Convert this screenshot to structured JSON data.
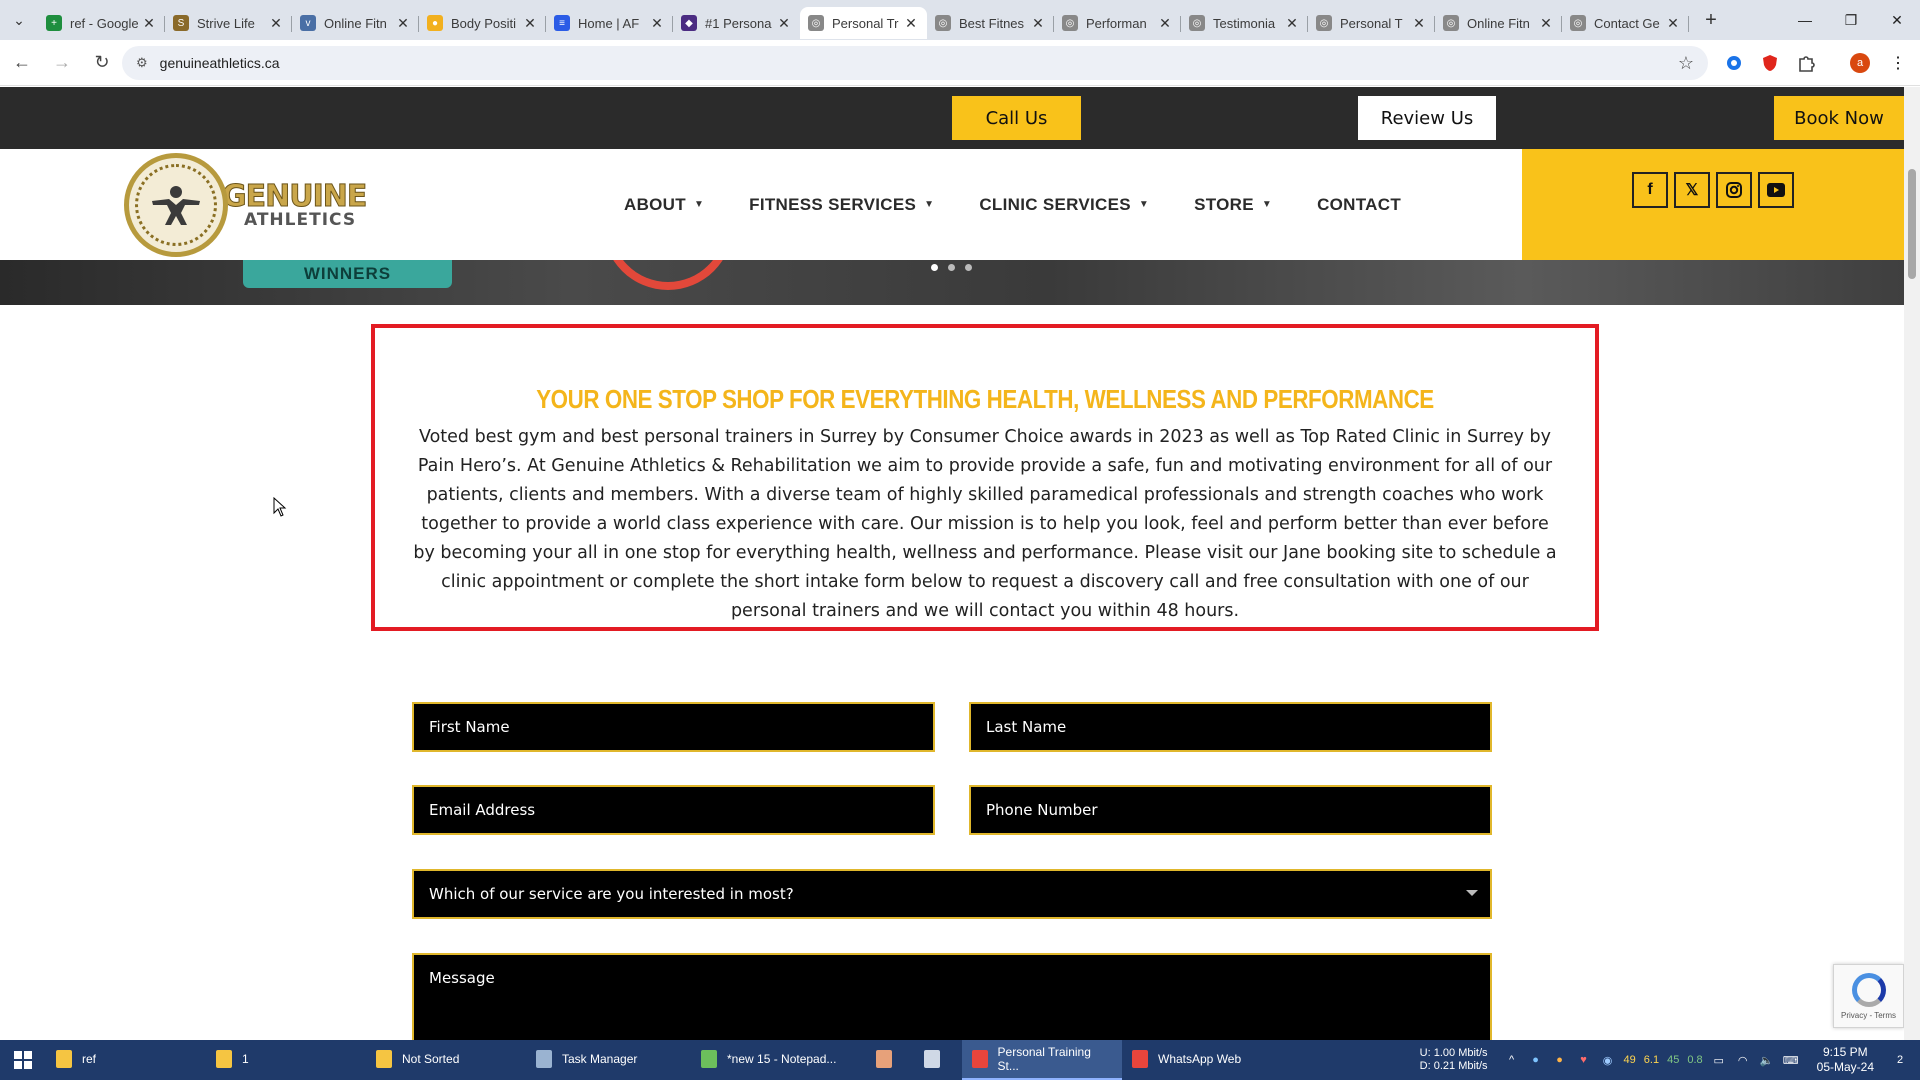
{
  "browser": {
    "tabs": [
      {
        "title": "ref - Google Sheets",
        "color": "#1e8e3e",
        "glyph": "+"
      },
      {
        "title": "Strive Life",
        "color": "#8a6a2a",
        "glyph": "S"
      },
      {
        "title": "Online Fitn",
        "color": "#4a6fa5",
        "glyph": "v"
      },
      {
        "title": "Body Positi",
        "color": "#f2b01e",
        "glyph": "●"
      },
      {
        "title": "Home | AF",
        "color": "#2b5ce6",
        "glyph": "≡"
      },
      {
        "title": "#1 Persona",
        "color": "#4b2c82",
        "glyph": "◆"
      },
      {
        "title": "Personal Tr",
        "color": "#888888",
        "glyph": "◎"
      },
      {
        "title": "Best Fitnes",
        "color": "#888888",
        "glyph": "◎"
      },
      {
        "title": "Performan",
        "color": "#888888",
        "glyph": "◎"
      },
      {
        "title": "Testimonia",
        "color": "#888888",
        "glyph": "◎"
      },
      {
        "title": "Personal T",
        "color": "#888888",
        "glyph": "◎"
      },
      {
        "title": "Online Fitn",
        "color": "#888888",
        "glyph": "◎"
      },
      {
        "title": "Contact Ge",
        "color": "#888888",
        "glyph": "◎"
      }
    ],
    "active_tab_index": 6,
    "url": "genuineathletics.ca",
    "profile_initial": "a"
  },
  "topbar": {
    "call_label": "Call Us",
    "review_label": "Review Us",
    "book_label": "Book Now"
  },
  "logo": {
    "line1": "GENUINE",
    "line2": "ATHLETICS"
  },
  "menu": {
    "about": "ABOUT",
    "fitness": "FITNESS SERVICES",
    "clinic": "CLINIC SERVICES",
    "store": "STORE",
    "contact": "CONTACT"
  },
  "social": [
    "facebook-icon",
    "x-icon",
    "instagram-icon",
    "youtube-icon"
  ],
  "hero": {
    "badge_text": "WINNERS"
  },
  "intro": {
    "heading": "YOUR ONE STOP SHOP FOR EVERYTHING HEALTH, WELLNESS AND PERFORMANCE",
    "body": "Voted best gym and best personal trainers in Surrey by Consumer Choice awards in 2023 as well as Top Rated Clinic in Surrey by Pain Hero’s.  At Genuine Athletics & Rehabilitation we aim to provide provide a safe, fun and motivating environment for all of our patients, clients and members. With a diverse team of highly skilled paramedical professionals and strength coaches who work together to provide a world class experience with care. Our mission is to help you look, feel and perform better than ever before by becoming your all in one stop for everything health, wellness and performance. Please visit our Jane booking site to schedule a clinic appointment or complete the short intake form below to request a discovery call and free consultation with one of our personal trainers and we will contact you within 48 hours."
  },
  "form": {
    "first_name": "First Name",
    "last_name": "Last Name",
    "email": "Email Address",
    "phone": "Phone Number",
    "service_select": "Which of our service are you interested in most?",
    "message": "Message"
  },
  "recaptcha": {
    "terms": "Privacy - Terms"
  },
  "taskbar": {
    "items": [
      {
        "label": "ref",
        "color": "#f5c542"
      },
      {
        "label": "1",
        "color": "#f5c542"
      },
      {
        "label": "Not Sorted",
        "color": "#f5c542"
      },
      {
        "label": "Task Manager",
        "color": "#9ab3d1"
      },
      {
        "label": "*new 15 - Notepad...",
        "color": "#6cbf5c"
      },
      {
        "label": "Personal Training St...",
        "color": "#e8453c"
      },
      {
        "label": "WhatsApp Web",
        "color": "#e8453c"
      }
    ],
    "net_up": "1.00 Mbit/s",
    "net_down": "0.21 Mbit/s",
    "net_up_label": "U:",
    "net_down_label": "D:",
    "tray_numbers": [
      "49",
      "6.1",
      "45",
      "0.8"
    ],
    "time": "9:15 PM",
    "date": "05-May-24",
    "notifications": "2"
  }
}
